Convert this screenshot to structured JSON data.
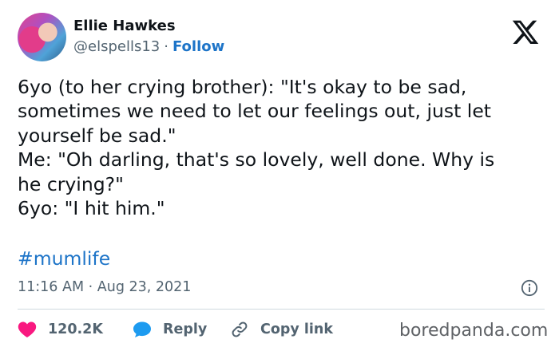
{
  "user": {
    "name": "Ellie Hawkes",
    "handle": "@elspells13",
    "separator": "·",
    "follow_label": "Follow"
  },
  "tweet": {
    "lines": [
      "6yo (to her crying brother): \"It's okay to be sad,",
      "sometimes we need to let our feelings out, just let",
      "yourself be sad.\"",
      "Me: \"Oh darling, that's so lovely, well done. Why is",
      "he crying?\"",
      "6yo: \"I hit him.\""
    ],
    "hashtag": "#mumlife",
    "timestamp": "11:16 AM · Aug 23, 2021"
  },
  "actions": {
    "likes": "120.2K",
    "reply_label": "Reply",
    "copy_label": "Copy link"
  },
  "watermark": "boredpanda.com",
  "icons": {
    "logo": "x-logo-icon",
    "info": "info-icon",
    "like": "heart-icon",
    "reply": "reply-bubble-icon",
    "copy": "link-icon"
  },
  "colors": {
    "accent": "#1d74c8",
    "heart": "#f91880",
    "reply": "#1d9bf0",
    "muted": "#536471"
  }
}
